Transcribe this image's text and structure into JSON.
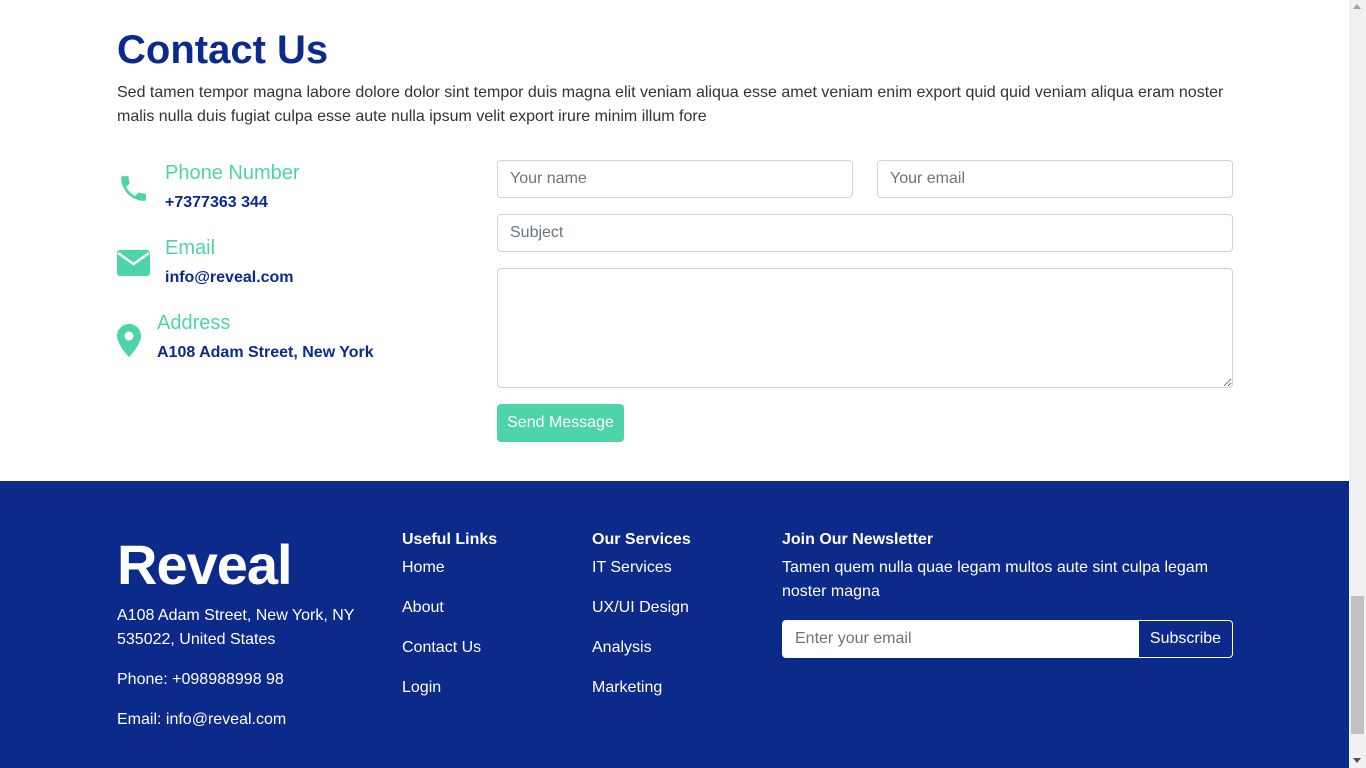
{
  "contact": {
    "title": "Contact Us",
    "description": "Sed tamen tempor magna labore dolore dolor sint tempor duis magna elit veniam aliqua esse amet veniam enim export quid quid veniam aliqua eram noster malis nulla duis fugiat culpa esse aute nulla ipsum velit export irure minim illum fore",
    "info": {
      "phone": {
        "label": "Phone Number",
        "value": "+7377363 344",
        "icon": "phone-icon"
      },
      "email": {
        "label": "Email",
        "value": "info@reveal.com",
        "icon": "envelope-icon"
      },
      "address": {
        "label": "Address",
        "value": "A108 Adam Street, New York",
        "icon": "map-pin-icon"
      }
    },
    "form": {
      "name_placeholder": "Your name",
      "email_placeholder": "Your email",
      "subject_placeholder": "Subject",
      "message_placeholder": "",
      "send_label": "Send Message"
    }
  },
  "footer": {
    "brand": "Reveal",
    "address": "A108 Adam Street, New York, NY 535022, United States",
    "phone": "Phone: +098988998 98",
    "email": "Email: info@reveal.com",
    "useful_links": {
      "title": "Useful Links",
      "items": [
        "Home",
        "About",
        "Contact Us",
        "Login"
      ]
    },
    "services": {
      "title": "Our Services",
      "items": [
        "IT Services",
        "UX/UI Design",
        "Analysis",
        "Marketing"
      ]
    },
    "newsletter": {
      "title": "Join Our Newsletter",
      "text": "Tamen quem nulla quae legam multos aute sint culpa legam noster magna",
      "placeholder": "Enter your email",
      "button": "Subscribe"
    }
  },
  "colors": {
    "primary": "#0c2a8a",
    "accent": "#4ed4a8"
  }
}
